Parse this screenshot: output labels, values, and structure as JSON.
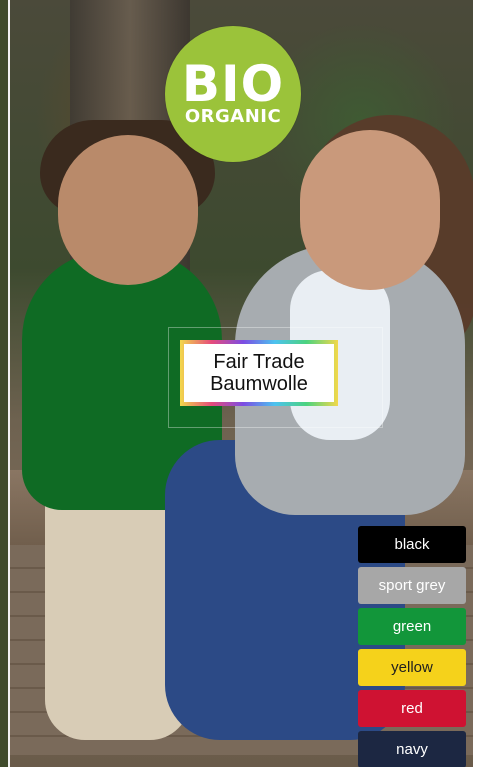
{
  "badge": {
    "main": "BIO",
    "sub": "ORGANIC",
    "color": "#9bc33a"
  },
  "label": {
    "line1": "Fair Trade",
    "line2": "Baumwolle"
  },
  "swatches": [
    {
      "name": "black",
      "color": "#000000"
    },
    {
      "name": "sport grey",
      "color": "#a7a7a7"
    },
    {
      "name": "green",
      "color": "#12963a"
    },
    {
      "name": "yellow",
      "color": "#f5d21b"
    },
    {
      "name": "red",
      "color": "#cf1232"
    },
    {
      "name": "navy",
      "color": "#1c2742"
    }
  ]
}
